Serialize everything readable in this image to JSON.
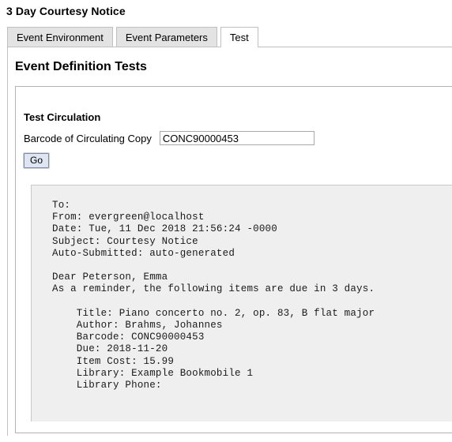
{
  "page": {
    "title": "3 Day Courtesy Notice"
  },
  "tabs": [
    {
      "label": "Event Environment",
      "active": false
    },
    {
      "label": "Event Parameters",
      "active": false
    },
    {
      "label": "Test",
      "active": true
    }
  ],
  "main": {
    "heading": "Event Definition Tests",
    "section": {
      "heading": "Test Circulation",
      "barcode_label": "Barcode of Circulating Copy",
      "barcode_value": "CONC90000453",
      "barcode_placeholder": "",
      "go_label": "Go"
    },
    "output": {
      "text": "To:\nFrom: evergreen@localhost\nDate: Tue, 11 Dec 2018 21:56:24 -0000\nSubject: Courtesy Notice\nAuto-Submitted: auto-generated\n\nDear Peterson, Emma\nAs a reminder, the following items are due in 3 days.\n\n    Title: Piano concerto no. 2, op. 83, B flat major\n    Author: Brahms, Johannes\n    Barcode: CONC90000453\n    Due: 2018-11-20\n    Item Cost: 15.99\n    Library: Example Bookmobile 1\n    Library Phone:",
      "fields": {
        "to": "To:",
        "from": "From: evergreen@localhost",
        "date": "Date: Tue, 11 Dec 2018 21:56:24 -0000",
        "subject": "Subject: Courtesy Notice",
        "auto_submitted": "Auto-Submitted: auto-generated",
        "greeting": "Dear Peterson, Emma",
        "reminder": "As a reminder, the following items are due in 3 days.",
        "item_title": "Title: Piano concerto no. 2, op. 83, B flat major",
        "item_author": "Author: Brahms, Johannes",
        "item_barcode": "Barcode: CONC90000453",
        "item_due": "Due: 2018-11-20",
        "item_cost": "Item Cost: 15.99",
        "item_library": "Library: Example Bookmobile 1",
        "item_library_phone": "Library Phone:"
      }
    }
  },
  "colors": {
    "tab_inactive_bg": "#e3e3e3",
    "tab_active_bg": "#ffffff",
    "border": "#c0c0c0",
    "output_bg": "#efefef",
    "button_bg": "#dfe6f2",
    "button_border": "#7a8ba6"
  }
}
